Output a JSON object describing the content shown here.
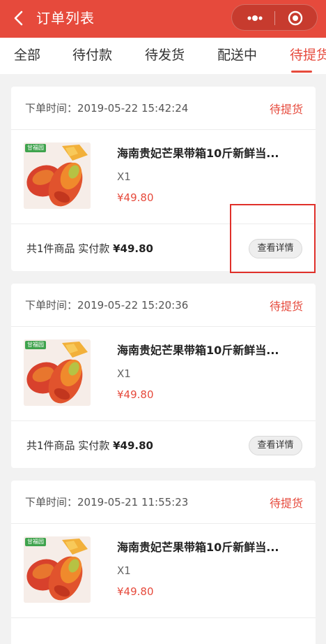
{
  "header": {
    "title": "订单列表",
    "back_icon": "chevron-left-icon",
    "more_icon": "more-dots-icon",
    "close_icon": "target-close-icon",
    "bg_color": "#e64a3c"
  },
  "tabs": [
    {
      "label": "全部",
      "active": false
    },
    {
      "label": "待付款",
      "active": false
    },
    {
      "label": "待发货",
      "active": false
    },
    {
      "label": "配送中",
      "active": false
    },
    {
      "label": "待提货",
      "active": true
    }
  ],
  "orders": [
    {
      "time_label": "下单时间：",
      "time": "2019-05-22 15:42:24",
      "status": "待提货",
      "product_name": "海南贵妃芒果带箱10斤新鲜当...",
      "quantity": "X1",
      "price": "¥49.80",
      "thumb_tag": "甘福园",
      "summary_prefix": "共1件商品 实付款",
      "summary_amount": "¥49.80",
      "detail_button": "查看详情"
    },
    {
      "time_label": "下单时间：",
      "time": "2019-05-22 15:20:36",
      "status": "待提货",
      "product_name": "海南贵妃芒果带箱10斤新鲜当...",
      "quantity": "X1",
      "price": "¥49.80",
      "thumb_tag": "甘福园",
      "summary_prefix": "共1件商品 实付款",
      "summary_amount": "¥49.80",
      "detail_button": "查看详情"
    },
    {
      "time_label": "下单时间：",
      "time": "2019-05-21 11:55:23",
      "status": "待提货",
      "product_name": "海南贵妃芒果带箱10斤新鲜当...",
      "quantity": "X1",
      "price": "¥49.80",
      "thumb_tag": "甘福园"
    }
  ],
  "accent_color": "#e64a3c"
}
